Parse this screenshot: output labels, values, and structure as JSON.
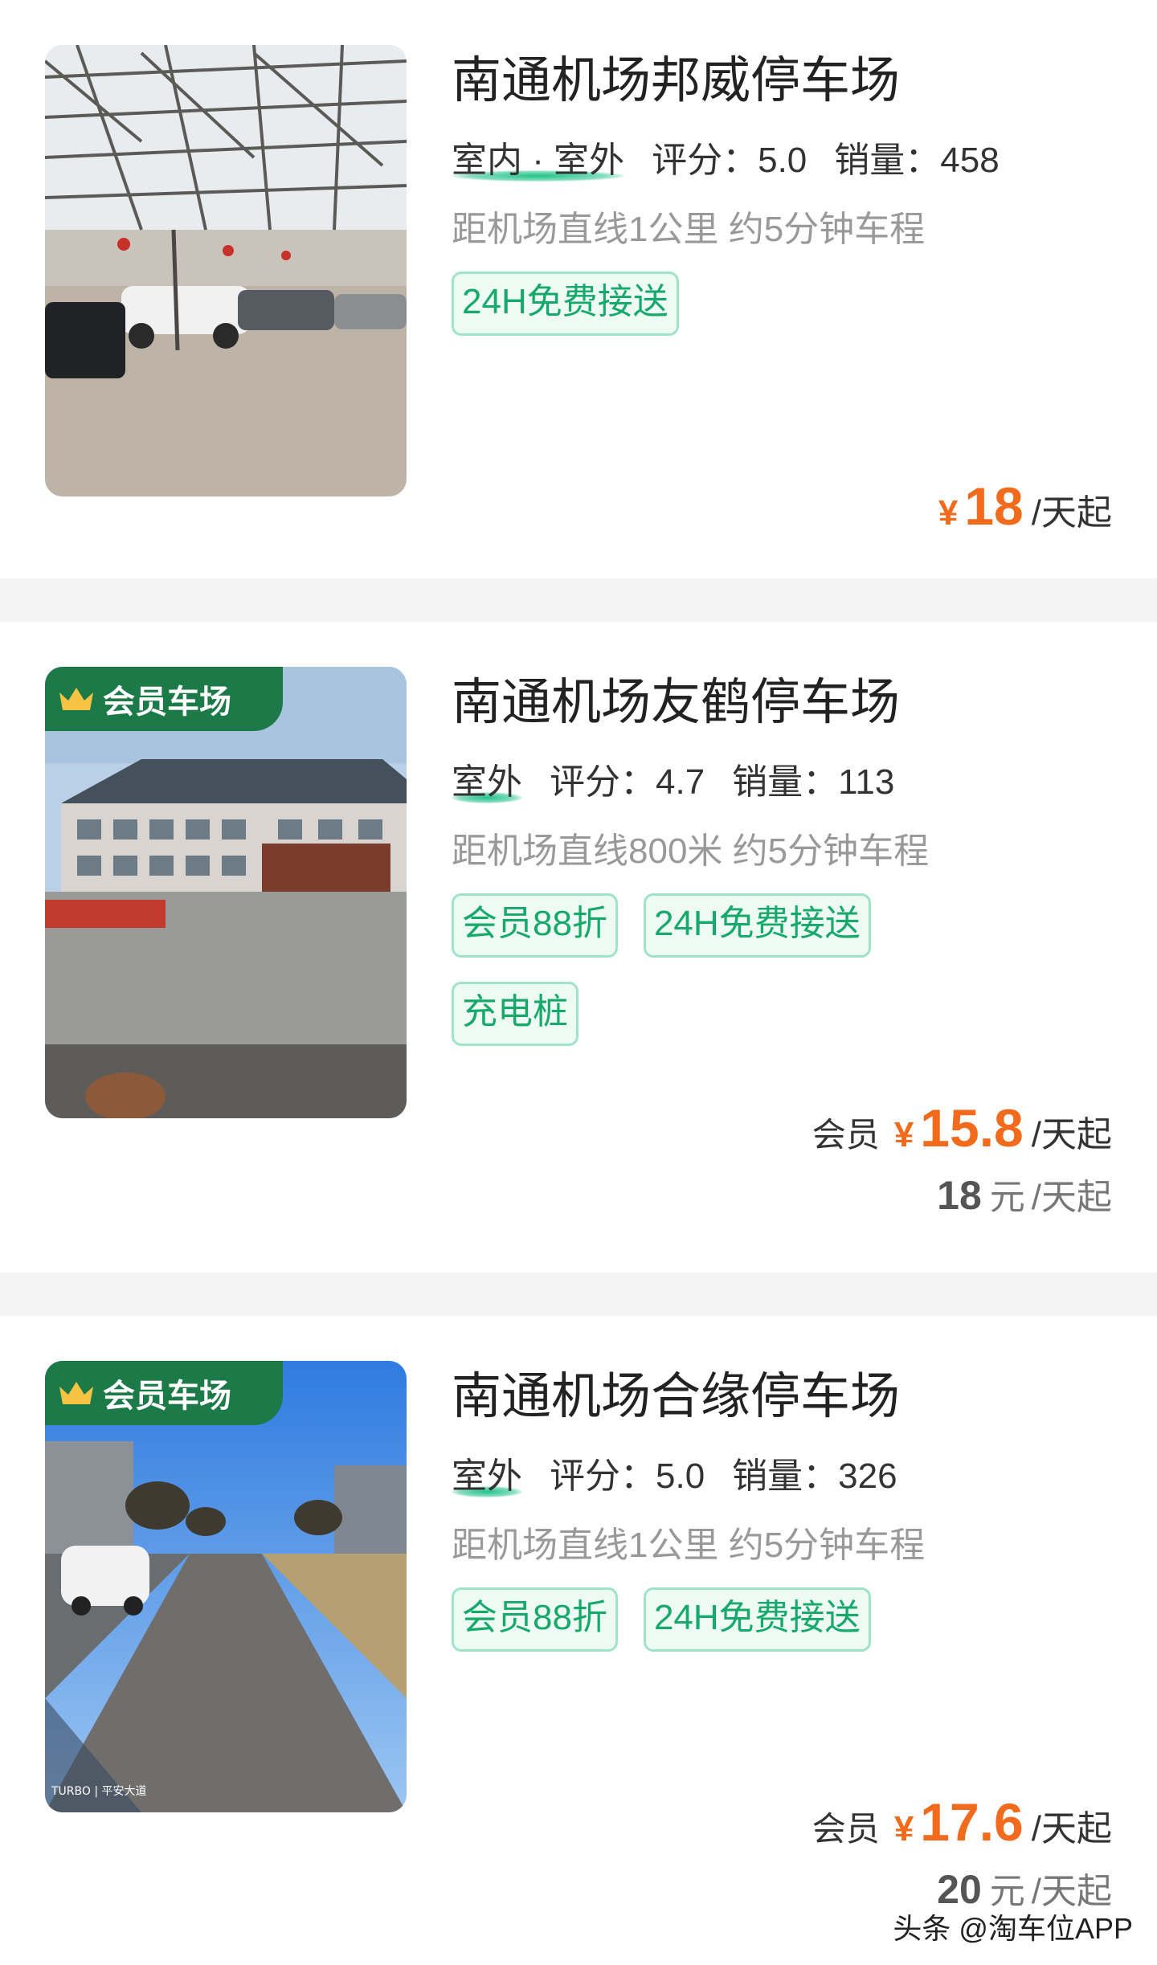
{
  "lots": [
    {
      "name": "南通机场邦威停车场",
      "location": "室内 · 室外",
      "rating_label": "评分：5.0",
      "sales_label": "销量：458",
      "distance": "距机场直线1公里 约5分钟车程",
      "tags": [
        "24H免费接送"
      ],
      "price": {
        "yen": "¥",
        "amount": "18",
        "unit": "/天起"
      }
    },
    {
      "name": "南通机场友鹤停车场",
      "member_badge": "会员车场",
      "location": "室外",
      "rating_label": "评分：4.7",
      "sales_label": "销量：113",
      "distance": "距机场直线800米 约5分钟车程",
      "tags": [
        "会员88折",
        "24H免费接送",
        "充电桩"
      ],
      "price": {
        "member_label": "会员",
        "yen": "¥",
        "amount": "15.8",
        "unit": "/天起"
      },
      "original_price": {
        "amount": "18",
        "yuan": "元",
        "unit": "/天起"
      }
    },
    {
      "name": "南通机场合缘停车场",
      "member_badge": "会员车场",
      "location": "室外",
      "rating_label": "评分：5.0",
      "sales_label": "销量：326",
      "distance": "距机场直线1公里 约5分钟车程",
      "tags": [
        "会员88折",
        "24H免费接送"
      ],
      "price": {
        "member_label": "会员",
        "yen": "¥",
        "amount": "17.6",
        "unit": "/天起"
      },
      "original_price": {
        "amount": "20",
        "yuan": "元",
        "unit": "/天起"
      },
      "photo_caption": "TURBO | 平安大道"
    }
  ],
  "watermark": "头条 @淘车位APP",
  "colors": {
    "accent_green": "#17a86b",
    "price_orange": "#f26a1b",
    "badge_green": "#1c7a48"
  },
  "icons": [
    "crown-icon"
  ]
}
